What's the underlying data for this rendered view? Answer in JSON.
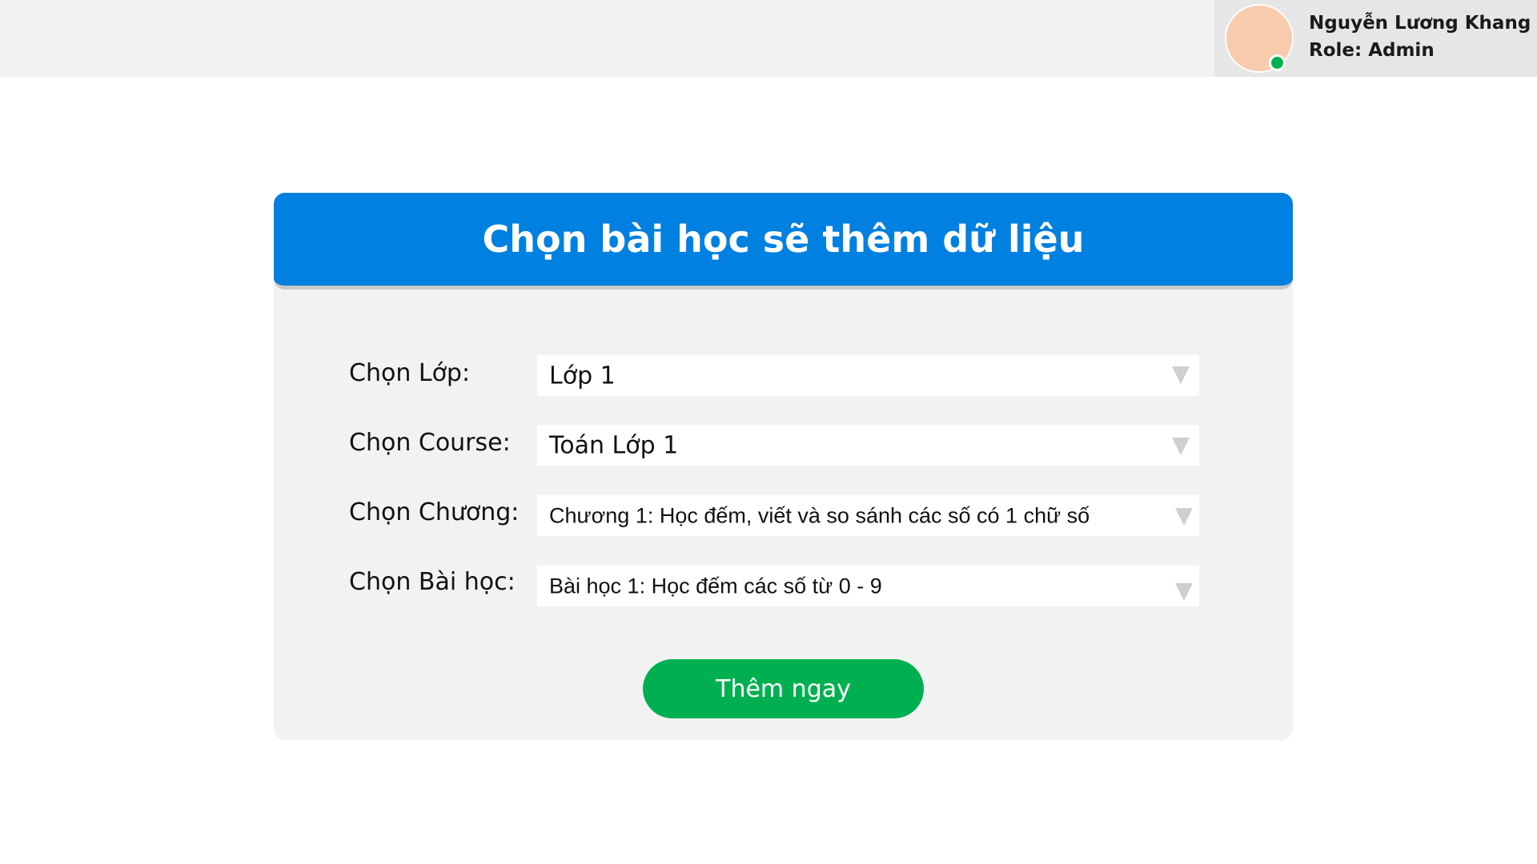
{
  "user": {
    "name": "Nguyễn Lương Khang",
    "role": "Role: Admin",
    "status": "online"
  },
  "form": {
    "title": "Chọn bài học sẽ thêm dữ liệu",
    "fields": [
      {
        "label": "Chọn Lớp:",
        "value": "Lớp 1"
      },
      {
        "label": "Chọn Course:",
        "value": "Toán Lớp 1"
      },
      {
        "label": "Chọn Chương:",
        "value": "Chương 1: Học đếm, viết và so sánh các số có 1 chữ số"
      },
      {
        "label": "Chọn Bài học:",
        "value": "Bài học 1: Học đếm các số từ 0 - 9"
      }
    ],
    "submit_label": "Thêm ngay"
  },
  "colors": {
    "header_blue": "#0080e0",
    "button_green": "#00b050",
    "online_green": "#00b050",
    "avatar_fill": "#f8cbad"
  },
  "icons": [
    "dropdown-arrow-icon",
    "avatar",
    "online-status-icon"
  ]
}
